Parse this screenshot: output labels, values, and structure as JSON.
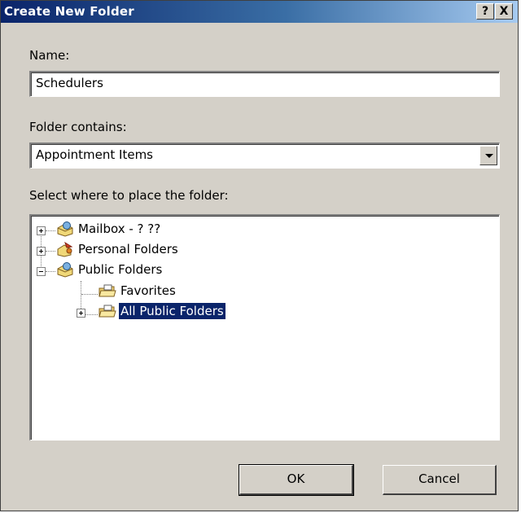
{
  "dialog": {
    "title": "Create New Folder",
    "help_label": "?",
    "close_label": "X"
  },
  "name": {
    "label": "Name:",
    "value": "Schedulers"
  },
  "folder_contains": {
    "label": "Folder contains:",
    "selected": "Appointment Items"
  },
  "location": {
    "label": "Select where to place the folder:",
    "tree": [
      {
        "label": "Mailbox - ? ??",
        "icon": "mailbox-icon",
        "expanded": false,
        "level": 0
      },
      {
        "label": "Personal Folders",
        "icon": "personal-folders-icon",
        "expanded": false,
        "level": 0
      },
      {
        "label": "Public Folders",
        "icon": "public-folders-icon",
        "expanded": true,
        "level": 0
      },
      {
        "label": "Favorites",
        "icon": "favorites-folder-icon",
        "expanded": null,
        "level": 1
      },
      {
        "label": "All Public Folders",
        "icon": "all-public-folders-icon",
        "expanded": false,
        "level": 1,
        "selected": true
      }
    ]
  },
  "buttons": {
    "ok": "OK",
    "cancel": "Cancel"
  },
  "colors": {
    "titlebar_start": "#0a246a",
    "titlebar_end": "#a6caf0",
    "dialog_bg": "#d4d0c8",
    "selection": "#0a246a"
  }
}
